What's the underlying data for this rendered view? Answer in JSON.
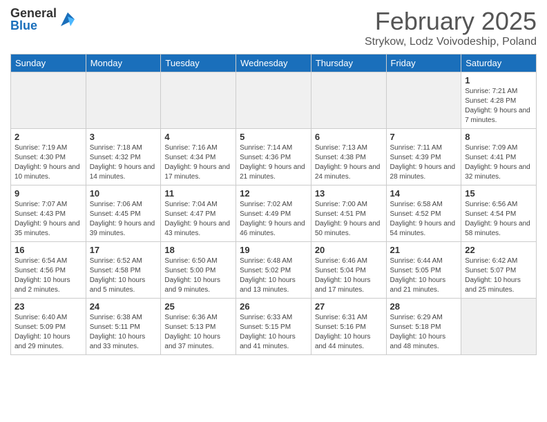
{
  "header": {
    "logo_general": "General",
    "logo_blue": "Blue",
    "month_title": "February 2025",
    "location": "Strykow, Lodz Voivodeship, Poland"
  },
  "weekdays": [
    "Sunday",
    "Monday",
    "Tuesday",
    "Wednesday",
    "Thursday",
    "Friday",
    "Saturday"
  ],
  "weeks": [
    [
      {
        "day": "",
        "info": ""
      },
      {
        "day": "",
        "info": ""
      },
      {
        "day": "",
        "info": ""
      },
      {
        "day": "",
        "info": ""
      },
      {
        "day": "",
        "info": ""
      },
      {
        "day": "",
        "info": ""
      },
      {
        "day": "1",
        "info": "Sunrise: 7:21 AM\nSunset: 4:28 PM\nDaylight: 9 hours and 7 minutes."
      }
    ],
    [
      {
        "day": "2",
        "info": "Sunrise: 7:19 AM\nSunset: 4:30 PM\nDaylight: 9 hours and 10 minutes."
      },
      {
        "day": "3",
        "info": "Sunrise: 7:18 AM\nSunset: 4:32 PM\nDaylight: 9 hours and 14 minutes."
      },
      {
        "day": "4",
        "info": "Sunrise: 7:16 AM\nSunset: 4:34 PM\nDaylight: 9 hours and 17 minutes."
      },
      {
        "day": "5",
        "info": "Sunrise: 7:14 AM\nSunset: 4:36 PM\nDaylight: 9 hours and 21 minutes."
      },
      {
        "day": "6",
        "info": "Sunrise: 7:13 AM\nSunset: 4:38 PM\nDaylight: 9 hours and 24 minutes."
      },
      {
        "day": "7",
        "info": "Sunrise: 7:11 AM\nSunset: 4:39 PM\nDaylight: 9 hours and 28 minutes."
      },
      {
        "day": "8",
        "info": "Sunrise: 7:09 AM\nSunset: 4:41 PM\nDaylight: 9 hours and 32 minutes."
      }
    ],
    [
      {
        "day": "9",
        "info": "Sunrise: 7:07 AM\nSunset: 4:43 PM\nDaylight: 9 hours and 35 minutes."
      },
      {
        "day": "10",
        "info": "Sunrise: 7:06 AM\nSunset: 4:45 PM\nDaylight: 9 hours and 39 minutes."
      },
      {
        "day": "11",
        "info": "Sunrise: 7:04 AM\nSunset: 4:47 PM\nDaylight: 9 hours and 43 minutes."
      },
      {
        "day": "12",
        "info": "Sunrise: 7:02 AM\nSunset: 4:49 PM\nDaylight: 9 hours and 46 minutes."
      },
      {
        "day": "13",
        "info": "Sunrise: 7:00 AM\nSunset: 4:51 PM\nDaylight: 9 hours and 50 minutes."
      },
      {
        "day": "14",
        "info": "Sunrise: 6:58 AM\nSunset: 4:52 PM\nDaylight: 9 hours and 54 minutes."
      },
      {
        "day": "15",
        "info": "Sunrise: 6:56 AM\nSunset: 4:54 PM\nDaylight: 9 hours and 58 minutes."
      }
    ],
    [
      {
        "day": "16",
        "info": "Sunrise: 6:54 AM\nSunset: 4:56 PM\nDaylight: 10 hours and 2 minutes."
      },
      {
        "day": "17",
        "info": "Sunrise: 6:52 AM\nSunset: 4:58 PM\nDaylight: 10 hours and 5 minutes."
      },
      {
        "day": "18",
        "info": "Sunrise: 6:50 AM\nSunset: 5:00 PM\nDaylight: 10 hours and 9 minutes."
      },
      {
        "day": "19",
        "info": "Sunrise: 6:48 AM\nSunset: 5:02 PM\nDaylight: 10 hours and 13 minutes."
      },
      {
        "day": "20",
        "info": "Sunrise: 6:46 AM\nSunset: 5:04 PM\nDaylight: 10 hours and 17 minutes."
      },
      {
        "day": "21",
        "info": "Sunrise: 6:44 AM\nSunset: 5:05 PM\nDaylight: 10 hours and 21 minutes."
      },
      {
        "day": "22",
        "info": "Sunrise: 6:42 AM\nSunset: 5:07 PM\nDaylight: 10 hours and 25 minutes."
      }
    ],
    [
      {
        "day": "23",
        "info": "Sunrise: 6:40 AM\nSunset: 5:09 PM\nDaylight: 10 hours and 29 minutes."
      },
      {
        "day": "24",
        "info": "Sunrise: 6:38 AM\nSunset: 5:11 PM\nDaylight: 10 hours and 33 minutes."
      },
      {
        "day": "25",
        "info": "Sunrise: 6:36 AM\nSunset: 5:13 PM\nDaylight: 10 hours and 37 minutes."
      },
      {
        "day": "26",
        "info": "Sunrise: 6:33 AM\nSunset: 5:15 PM\nDaylight: 10 hours and 41 minutes."
      },
      {
        "day": "27",
        "info": "Sunrise: 6:31 AM\nSunset: 5:16 PM\nDaylight: 10 hours and 44 minutes."
      },
      {
        "day": "28",
        "info": "Sunrise: 6:29 AM\nSunset: 5:18 PM\nDaylight: 10 hours and 48 minutes."
      },
      {
        "day": "",
        "info": ""
      }
    ]
  ]
}
